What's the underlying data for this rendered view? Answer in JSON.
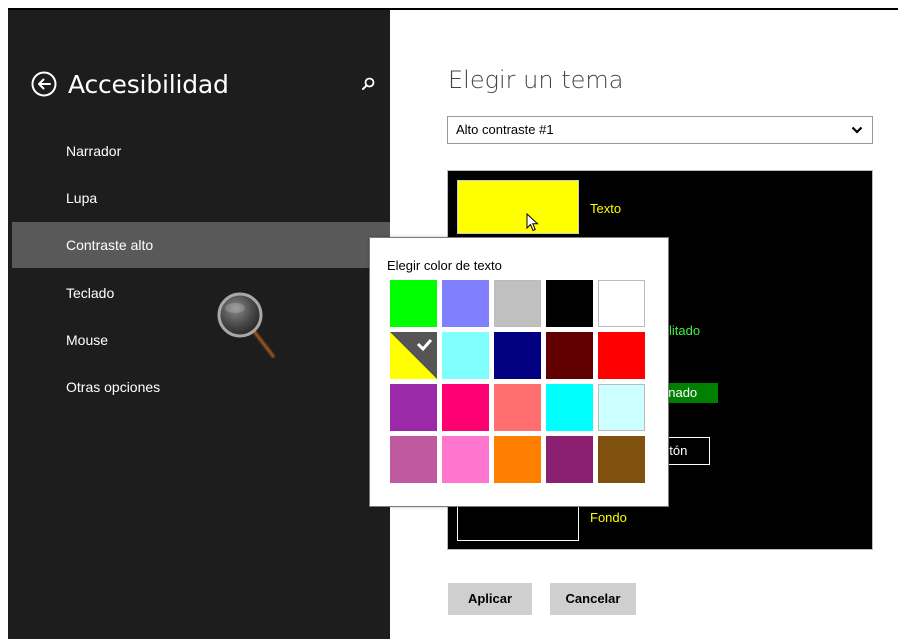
{
  "sidebar": {
    "title": "Accesibilidad",
    "items": [
      {
        "label": "Narrador"
      },
      {
        "label": "Lupa"
      },
      {
        "label": "Contraste alto"
      },
      {
        "label": "Teclado"
      },
      {
        "label": "Mouse"
      },
      {
        "label": "Otras opciones"
      }
    ],
    "selected_index": 2
  },
  "main": {
    "title": "Elegir un tema",
    "theme_select": {
      "value": "Alto contraste #1"
    },
    "preview": {
      "text_label": "Texto",
      "disabled_label": "litado",
      "selected_label": "onado",
      "button_label": "otón",
      "background_label": "Fondo"
    },
    "apply_label": "Aplicar",
    "cancel_label": "Cancelar"
  },
  "color_picker": {
    "title": "Elegir color de texto",
    "colors": [
      "#00ff00",
      "#8080ff",
      "#c0c0c0",
      "#000000",
      "#ffffff",
      "#ffff00",
      "#80ffff",
      "#000080",
      "#600000",
      "#ff0000",
      "#9a2aa8",
      "#ff0073",
      "#ff6f6f",
      "#00ffff",
      "#ccffff",
      "#c05aa0",
      "#ff76cf",
      "#ff7f00",
      "#8b2070",
      "#80500f"
    ],
    "selected_index": 5
  },
  "colors": {
    "sidebar_bg": "#1d1d1d",
    "selected_bg": "#595959",
    "text_color": "#ffff00",
    "disabled_color": "#3ff23f",
    "selected_bg_preview": "#008000"
  }
}
